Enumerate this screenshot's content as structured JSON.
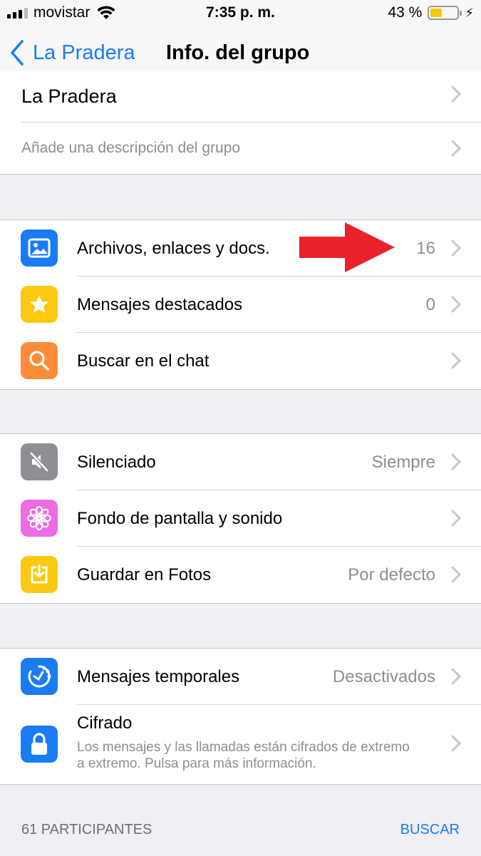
{
  "status_bar": {
    "carrier": "movistar",
    "time": "7:35 p. m.",
    "battery": "43 %",
    "battery_level": 0.43
  },
  "nav": {
    "back_label": "La Pradera",
    "title": "Info. del grupo"
  },
  "group_info": {
    "name": "La Pradera",
    "description_placeholder": "Añade una descripción del grupo"
  },
  "media_section": [
    {
      "label": "Archivos, enlaces y docs.",
      "value": "16",
      "icon": "photo-icon",
      "color": "#1a7cf5"
    },
    {
      "label": "Mensajes destacados",
      "value": "0",
      "icon": "star-icon",
      "color": "#fbc90f"
    },
    {
      "label": "Buscar en el chat",
      "value": "",
      "icon": "search-icon",
      "color": "#fd8c3a"
    }
  ],
  "settings_section": [
    {
      "label": "Silenciado",
      "value": "Siempre",
      "icon": "mute-icon",
      "color": "#8e8e93"
    },
    {
      "label": "Fondo de pantalla y sonido",
      "value": "",
      "icon": "flower-icon",
      "color": "#ec6ce4"
    },
    {
      "label": "Guardar en Fotos",
      "value": "Por defecto",
      "icon": "download-icon",
      "color": "#fbc90f"
    }
  ],
  "privacy_section": {
    "temporales": {
      "label": "Mensajes temporales",
      "value": "Desactivados",
      "icon": "timer-icon",
      "color": "#1a7cf5"
    },
    "cifrado": {
      "label": "Cifrado",
      "subtext": "Los mensajes y las llamadas están cifrados de extremo a extremo. Pulsa para más información.",
      "icon": "lock-icon",
      "color": "#1a7cf5"
    }
  },
  "participants": {
    "count_label": "61 PARTICIPANTES",
    "search_label": "BUSCAR"
  },
  "colors": {
    "accent": "#1a7cf5",
    "arrow": "#e8232b"
  }
}
